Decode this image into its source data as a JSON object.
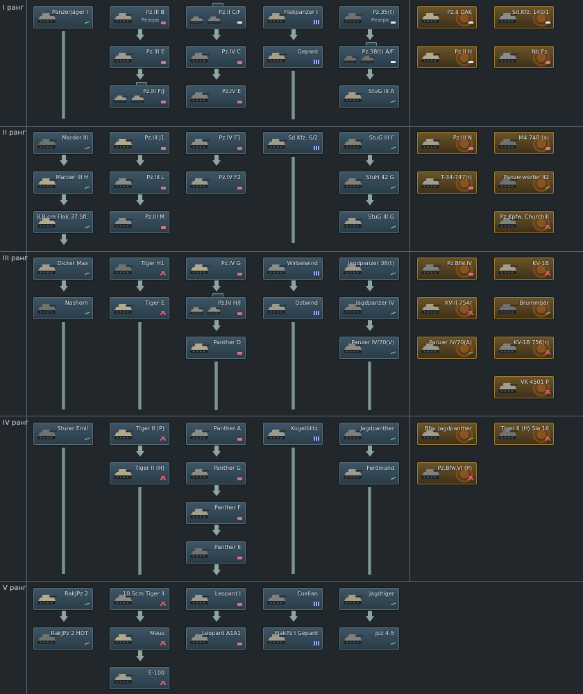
{
  "ranks": [
    {
      "label": "I ранг"
    },
    {
      "label": "II ранг"
    },
    {
      "label": "III ранг"
    },
    {
      "label": "IV ранг"
    },
    {
      "label": "V ранг"
    }
  ],
  "vehicles": [
    {
      "name": "Panzerjäger I",
      "icon": "td-icon",
      "premium": false,
      "sub": ""
    },
    {
      "name": "Pz.III B",
      "icon": "medium-tank-icon",
      "premium": false,
      "sub": "Резерв"
    },
    {
      "name": "Pz.II C/F",
      "icon": "light-tank-icon",
      "premium": false,
      "sub": ""
    },
    {
      "name": "Flakpanzer I",
      "icon": "spaa-icon",
      "premium": false,
      "sub": ""
    },
    {
      "name": "Pz.35(t)",
      "icon": "light-tank-icon",
      "premium": false,
      "sub": "Резерв"
    },
    {
      "name": "Pz.II DAK",
      "icon": "light-tank-icon",
      "premium": true,
      "sub": ""
    },
    {
      "name": "Sd.Kfz. 140/1",
      "icon": "light-tank-icon",
      "premium": true,
      "sub": ""
    },
    {
      "name": "Pz.III E",
      "icon": "medium-tank-icon",
      "premium": false,
      "sub": ""
    },
    {
      "name": "Pz.IV C",
      "icon": "medium-tank-icon",
      "premium": false,
      "sub": ""
    },
    {
      "name": "Gepard",
      "icon": "spaa-icon",
      "premium": false,
      "sub": ""
    },
    {
      "name": "Pz.38(t) A/F",
      "icon": "light-tank-icon",
      "premium": false,
      "sub": ""
    },
    {
      "name": "Pz.II H",
      "icon": "light-tank-icon",
      "premium": true,
      "sub": ""
    },
    {
      "name": "Nb.Fz.",
      "icon": "medium-tank-icon",
      "premium": true,
      "sub": ""
    },
    {
      "name": "Pz.III F/J",
      "icon": "medium-tank-icon",
      "premium": false,
      "sub": ""
    },
    {
      "name": "Pz.IV E",
      "icon": "medium-tank-icon",
      "premium": false,
      "sub": ""
    },
    {
      "name": "StuG III A",
      "icon": "td-icon",
      "premium": false,
      "sub": ""
    },
    {
      "name": "Marder III",
      "icon": "td-icon",
      "premium": false,
      "sub": ""
    },
    {
      "name": "Pz.III J1",
      "icon": "medium-tank-icon",
      "premium": false,
      "sub": ""
    },
    {
      "name": "Pz.IV F1",
      "icon": "medium-tank-icon",
      "premium": false,
      "sub": ""
    },
    {
      "name": "Sd.Kfz. 6/2",
      "icon": "spaa-icon",
      "premium": false,
      "sub": ""
    },
    {
      "name": "StuG III F",
      "icon": "td-icon",
      "premium": false,
      "sub": ""
    },
    {
      "name": "Pz.III N",
      "icon": "medium-tank-icon",
      "premium": true,
      "sub": ""
    },
    {
      "name": "M4 748 (a)",
      "icon": "medium-tank-icon",
      "premium": true,
      "sub": ""
    },
    {
      "name": "Marder III H",
      "icon": "td-icon",
      "premium": false,
      "sub": ""
    },
    {
      "name": "Pz.III L",
      "icon": "medium-tank-icon",
      "premium": false,
      "sub": ""
    },
    {
      "name": "Pz.IV F2",
      "icon": "medium-tank-icon",
      "premium": false,
      "sub": ""
    },
    {
      "name": "StuH 42 G",
      "icon": "td-icon",
      "premium": false,
      "sub": ""
    },
    {
      "name": "T-34-747(r)",
      "icon": "medium-tank-icon",
      "premium": true,
      "sub": ""
    },
    {
      "name": "Panzerwerfer 42",
      "icon": "td-icon",
      "premium": true,
      "sub": ""
    },
    {
      "name": "8,8 cm Flak 37 Sfl.",
      "icon": "td-icon",
      "premium": false,
      "sub": ""
    },
    {
      "name": "Pz.III M",
      "icon": "medium-tank-icon",
      "premium": false,
      "sub": ""
    },
    {
      "name": "StuG III G",
      "icon": "td-icon",
      "premium": false,
      "sub": ""
    },
    {
      "name": "Pz.Kpfw. Churchill",
      "icon": "heavy-tank-icon",
      "premium": true,
      "sub": ""
    },
    {
      "name": "Dicker Max",
      "icon": "td-icon",
      "premium": false,
      "sub": ""
    },
    {
      "name": "Tiger H1",
      "icon": "heavy-tank-icon",
      "premium": false,
      "sub": ""
    },
    {
      "name": "Pz.IV G",
      "icon": "medium-tank-icon",
      "premium": false,
      "sub": ""
    },
    {
      "name": "Wirbelwind",
      "icon": "spaa-icon",
      "premium": false,
      "sub": ""
    },
    {
      "name": "Jagdpanzer 38(t)",
      "icon": "td-icon",
      "premium": false,
      "sub": ""
    },
    {
      "name": "Pz.Bfw.IV",
      "icon": "medium-tank-icon",
      "premium": true,
      "sub": ""
    },
    {
      "name": "KV-1B",
      "icon": "heavy-tank-icon",
      "premium": true,
      "sub": ""
    },
    {
      "name": "Nashorn",
      "icon": "td-icon",
      "premium": false,
      "sub": ""
    },
    {
      "name": "Tiger E",
      "icon": "heavy-tank-icon",
      "premium": false,
      "sub": ""
    },
    {
      "name": "Pz.IV H/J",
      "icon": "medium-tank-icon",
      "premium": false,
      "sub": ""
    },
    {
      "name": "Ostwind",
      "icon": "spaa-icon",
      "premium": false,
      "sub": ""
    },
    {
      "name": "Jagdpanzer IV",
      "icon": "td-icon",
      "premium": false,
      "sub": ""
    },
    {
      "name": "KV-II 754r",
      "icon": "heavy-tank-icon",
      "premium": true,
      "sub": ""
    },
    {
      "name": "Brummbär",
      "icon": "td-icon",
      "premium": true,
      "sub": ""
    },
    {
      "name": "Panther D",
      "icon": "medium-tank-icon",
      "premium": false,
      "sub": ""
    },
    {
      "name": "Panzer IV/70(V)",
      "icon": "td-icon",
      "premium": false,
      "sub": ""
    },
    {
      "name": "Panzer IV/70(A)",
      "icon": "td-icon",
      "premium": true,
      "sub": ""
    },
    {
      "name": "KV-1B 756(r)",
      "icon": "heavy-tank-icon",
      "premium": true,
      "sub": ""
    },
    {
      "name": "VK 4501 P",
      "icon": "heavy-tank-icon",
      "premium": true,
      "sub": ""
    },
    {
      "name": "Sturer Emil",
      "icon": "td-icon",
      "premium": false,
      "sub": ""
    },
    {
      "name": "Tiger II (P)",
      "icon": "heavy-tank-icon",
      "premium": false,
      "sub": ""
    },
    {
      "name": "Panther A",
      "icon": "medium-tank-icon",
      "premium": false,
      "sub": ""
    },
    {
      "name": "Kugelblitz",
      "icon": "spaa-icon",
      "premium": false,
      "sub": ""
    },
    {
      "name": "Jagdpanther",
      "icon": "td-icon",
      "premium": false,
      "sub": ""
    },
    {
      "name": "Bfw. Jagdpanther",
      "icon": "td-icon",
      "premium": true,
      "sub": ""
    },
    {
      "name": "Tiger II (H) Sla.16",
      "icon": "heavy-tank-icon",
      "premium": true,
      "sub": ""
    },
    {
      "name": "Tiger II (H)",
      "icon": "heavy-tank-icon",
      "premium": false,
      "sub": ""
    },
    {
      "name": "Panther G",
      "icon": "medium-tank-icon",
      "premium": false,
      "sub": ""
    },
    {
      "name": "Ferdinand",
      "icon": "td-icon",
      "premium": false,
      "sub": ""
    },
    {
      "name": "Pz.Bfw.VI (P)",
      "icon": "heavy-tank-icon",
      "premium": true,
      "sub": ""
    },
    {
      "name": "Panther F",
      "icon": "medium-tank-icon",
      "premium": false,
      "sub": ""
    },
    {
      "name": "Panther II",
      "icon": "medium-tank-icon",
      "premium": false,
      "sub": ""
    },
    {
      "name": "RakJPz 2",
      "icon": "td-icon",
      "premium": false,
      "sub": ""
    },
    {
      "name": "10,5cm Tiger II",
      "icon": "heavy-tank-icon",
      "premium": false,
      "sub": ""
    },
    {
      "name": "Leopard I",
      "icon": "medium-tank-icon",
      "premium": false,
      "sub": ""
    },
    {
      "name": "Coelian",
      "icon": "spaa-icon",
      "premium": false,
      "sub": ""
    },
    {
      "name": "Jagdtiger",
      "icon": "td-icon",
      "premium": false,
      "sub": ""
    },
    {
      "name": "RakJPz 2 HOT",
      "icon": "td-icon",
      "premium": false,
      "sub": ""
    },
    {
      "name": "Maus",
      "icon": "heavy-tank-icon",
      "premium": false,
      "sub": ""
    },
    {
      "name": "Leopard A1A1",
      "icon": "medium-tank-icon",
      "premium": false,
      "sub": ""
    },
    {
      "name": "FlakPz I Gepard",
      "icon": "spaa-icon",
      "premium": false,
      "sub": ""
    },
    {
      "name": "Jpz 4-5",
      "icon": "td-icon",
      "premium": false,
      "sub": ""
    },
    {
      "name": "E-100",
      "icon": "heavy-tank-icon",
      "premium": false,
      "sub": ""
    }
  ],
  "colors": {
    "background": "#22272b",
    "card": "#34495a",
    "premium_card": "#5c4824",
    "connector": "#7c9590",
    "td": "#7fd37a",
    "medium": "#e0708a",
    "heavy": "#e05a6a",
    "light": "#e8e8e8",
    "spaa": "#9aa6f0"
  }
}
